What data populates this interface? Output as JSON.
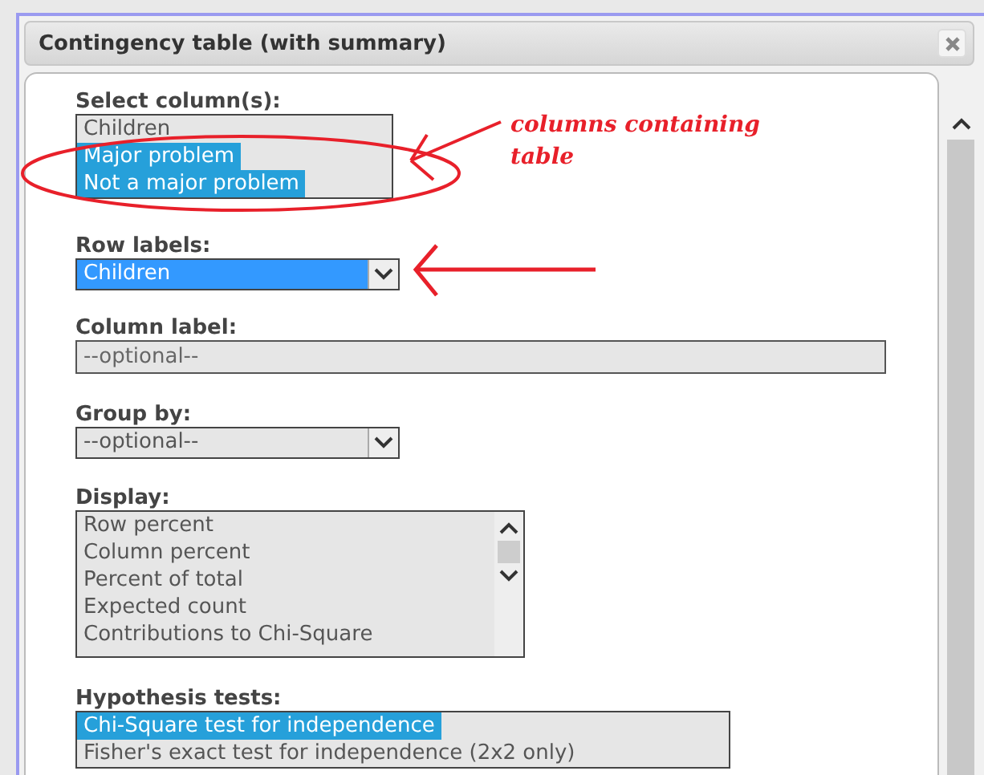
{
  "window": {
    "title": "Contingency table (with summary)"
  },
  "fields": [
    {
      "kind": "listbox",
      "label": "Select column(s):",
      "scrollbar": false,
      "items": [
        {
          "text": "Children",
          "selected": false
        },
        {
          "text": "Major problem",
          "selected": true
        },
        {
          "text": "Not a major problem",
          "selected": true
        }
      ]
    },
    {
      "kind": "select",
      "label": "Row labels:",
      "value": "Children",
      "focused": true
    },
    {
      "kind": "input",
      "label": "Column label:",
      "placeholder": "--optional--"
    },
    {
      "kind": "select",
      "label": "Group by:",
      "value": "--optional--",
      "focused": false
    },
    {
      "kind": "listbox",
      "label": "Display:",
      "scrollbar": true,
      "items": [
        {
          "text": "Row percent",
          "selected": false
        },
        {
          "text": "Column percent",
          "selected": false
        },
        {
          "text": "Percent of total",
          "selected": false
        },
        {
          "text": "Expected count",
          "selected": false
        },
        {
          "text": "Contributions to Chi-Square",
          "selected": false
        }
      ]
    },
    {
      "kind": "listbox",
      "label": "Hypothesis tests:",
      "scrollbar": false,
      "items": [
        {
          "text": "Chi-Square test for independence",
          "selected": true
        },
        {
          "text": "Fisher's exact test for independence (2x2 only)",
          "selected": false
        }
      ]
    }
  ],
  "annotation": {
    "text": "columns containing table"
  }
}
